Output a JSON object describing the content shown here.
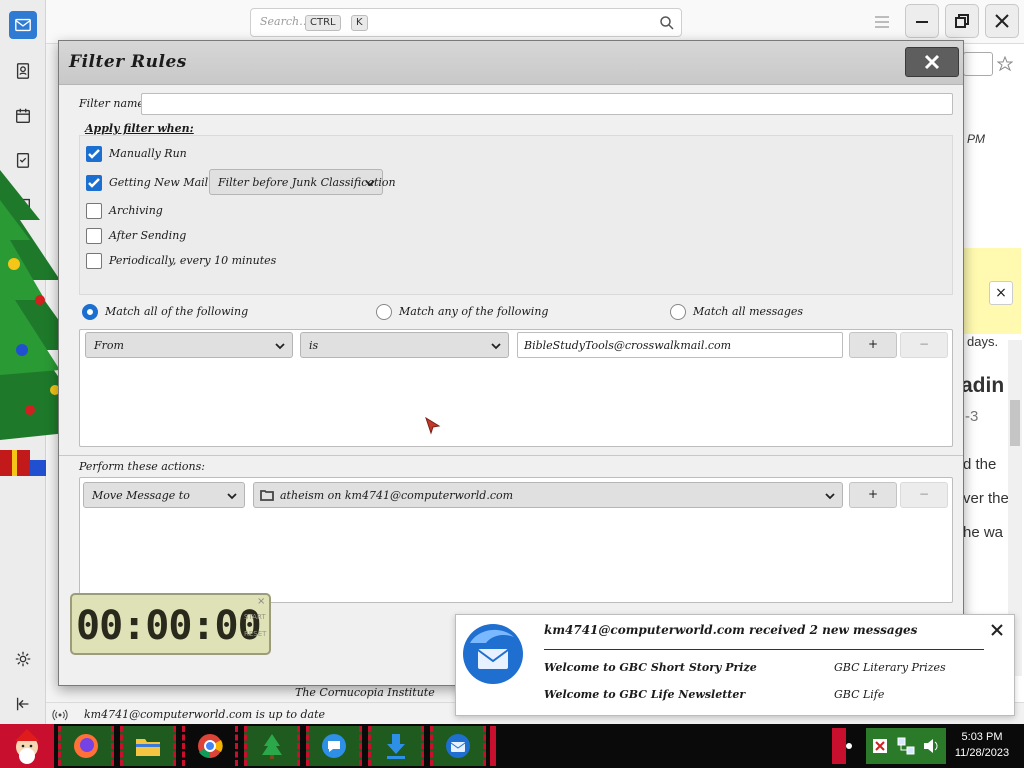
{
  "toolbar": {
    "search_placeholder": "Search…",
    "kbd_ctrl": "CTRL",
    "kbd_k": "K"
  },
  "spaces": [
    "mail-icon",
    "address-book-icon",
    "calendar-icon",
    "tasks-icon",
    "chat-icon"
  ],
  "dialog": {
    "title": "Filter Rules",
    "filter_name_label": "Filter name:",
    "filter_name_value": "",
    "apply_label": "Apply filter when:",
    "apply_options": [
      {
        "label": "Manually Run",
        "checked": true
      },
      {
        "label": "Getting New Mail:",
        "checked": true
      },
      {
        "label": "Archiving",
        "checked": false
      },
      {
        "label": "After Sending",
        "checked": false
      },
      {
        "label": "Periodically, every 10 minutes",
        "checked": false
      }
    ],
    "new_mail_mode": "Filter before Junk Classification",
    "match_options": [
      {
        "label": "Match all of the following",
        "selected": true
      },
      {
        "label": "Match any of the following",
        "selected": false
      },
      {
        "label": "Match all messages",
        "selected": false
      }
    ],
    "rule": {
      "field": "From",
      "operator": "is",
      "value": "BibleStudyTools@crosswalkmail.com",
      "add": "+",
      "remove": "−"
    },
    "actions_label": "Perform these actions:",
    "action": {
      "type": "Move Message to",
      "target": "atheism on km4741@computerworld.com",
      "add": "+",
      "remove": "−"
    }
  },
  "clock_widget": {
    "display": "00:00:00",
    "start": "START",
    "reset": "RESET"
  },
  "notification": {
    "title": "km4741@computerworld.com received 2 new messages",
    "messages": [
      {
        "subject": "Welcome to GBC Short Story Prize",
        "sender": "GBC Literary Prizes"
      },
      {
        "subject": "Welcome to GBC Life Newsletter",
        "sender": "GBC Life"
      }
    ]
  },
  "background": {
    "footer_text": "The Cornucopia Institute",
    "time_fragment": "PM",
    "days_fragment": "days.",
    "heading_fragment": "adin",
    "sub_fragment": "-3",
    "line1": "d the",
    "line2": "ver the",
    "line3": "he wa"
  },
  "status": {
    "text": "km4741@computerworld.com is up to date"
  },
  "taskbar": {
    "time": "5:03 PM",
    "date": "11/28/2023"
  }
}
